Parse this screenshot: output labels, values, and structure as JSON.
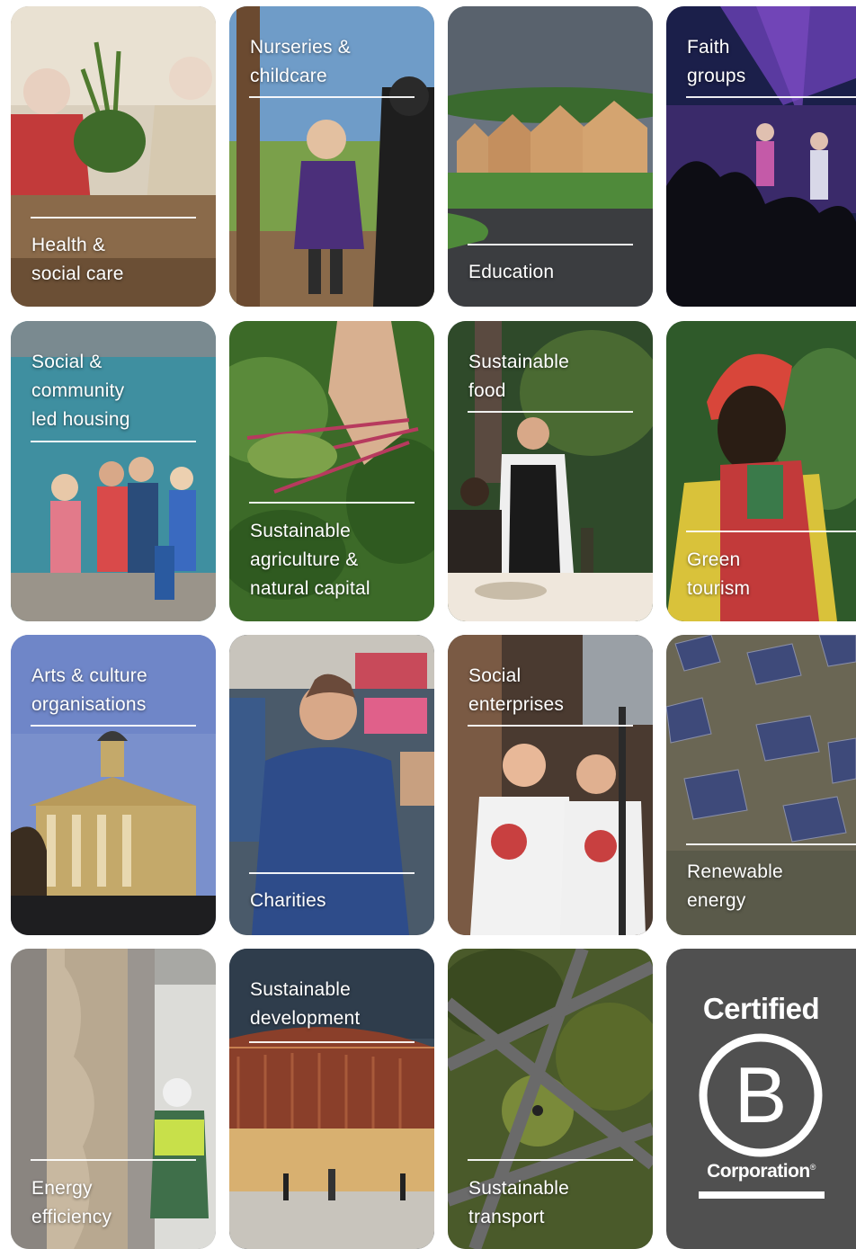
{
  "tiles": [
    {
      "id": "health",
      "label": "Health &\nsocial care",
      "label_pos": "bottom",
      "colors": [
        "#8a6a4a",
        "#d8cdb8",
        "#c23a3a",
        "#3f6b2a"
      ]
    },
    {
      "id": "nurseries",
      "label": "Nurseries &\nchildcare",
      "label_pos": "top",
      "colors": [
        "#5e8fc4",
        "#7aa04a",
        "#4b2f7a",
        "#2c2c2c"
      ]
    },
    {
      "id": "education",
      "label": "Education",
      "label_pos": "bottom",
      "colors": [
        "#5b6570",
        "#3f7a38",
        "#c99a6a",
        "#3b3d40"
      ]
    },
    {
      "id": "faith",
      "label": "Faith\ngroups",
      "label_pos": "top",
      "colors": [
        "#1b1f4a",
        "#5a3aa0",
        "#c45aa8",
        "#0d0d14"
      ]
    },
    {
      "id": "housing",
      "label": "Social &\ncommunity\nled housing",
      "label_pos": "top",
      "colors": [
        "#3f8fa0",
        "#2f6f80",
        "#c94a4a",
        "#2a4c7a"
      ]
    },
    {
      "id": "agriculture",
      "label": "Sustainable\nagriculture &\nnatural capital",
      "label_pos": "bottom",
      "colors": [
        "#3c6a28",
        "#7da24a",
        "#b73a5e",
        "#d8b090"
      ]
    },
    {
      "id": "food",
      "label": "Sustainable\nfood",
      "label_pos": "top",
      "colors": [
        "#2f4a2a",
        "#5a7a3a",
        "#1a1a1a",
        "#efe7dc"
      ]
    },
    {
      "id": "tourism",
      "label": "Green\ntourism",
      "label_pos": "bottom",
      "colors": [
        "#2f5a2a",
        "#d9c23a",
        "#c23a3a",
        "#2a1d14"
      ]
    },
    {
      "id": "arts",
      "label": "Arts & culture\norganisations",
      "label_pos": "top",
      "colors": [
        "#6f86c8",
        "#2a3a6a",
        "#c4a96a",
        "#3a2d20"
      ]
    },
    {
      "id": "charities",
      "label": "Charities",
      "label_pos": "bottom",
      "colors": [
        "#4a5a6a",
        "#c84a5a",
        "#2e4c8a",
        "#c8a080"
      ]
    },
    {
      "id": "social-ent",
      "label": "Social\nenterprises",
      "label_pos": "top",
      "colors": [
        "#4a3a30",
        "#7a5a44",
        "#f2f2f2",
        "#2a2a2a"
      ]
    },
    {
      "id": "renewable",
      "label": "Renewable\nenergy",
      "label_pos": "bottom",
      "colors": [
        "#5a5a4a",
        "#6f6a58",
        "#3e4a7a",
        "#7a7a66"
      ]
    },
    {
      "id": "energy-eff",
      "label": "Energy\nefficiency",
      "label_pos": "bottom",
      "colors": [
        "#8a8580",
        "#c8b8a0",
        "#3f6f4a",
        "#dcdcd8"
      ]
    },
    {
      "id": "development",
      "label": "Sustainable\ndevelopment",
      "label_pos": "top",
      "colors": [
        "#3a4a5a",
        "#8a3f2a",
        "#d8b070",
        "#c8c4bc"
      ]
    },
    {
      "id": "transport",
      "label": "Sustainable\ntransport",
      "label_pos": "bottom",
      "colors": [
        "#4a5a2a",
        "#7a8a3a",
        "#6a6a6a",
        "#3a4222"
      ]
    }
  ],
  "bcorp": {
    "line1": "Certified",
    "letter": "B",
    "line2": "Corporation",
    "registered": "®",
    "bg": "#505050"
  }
}
